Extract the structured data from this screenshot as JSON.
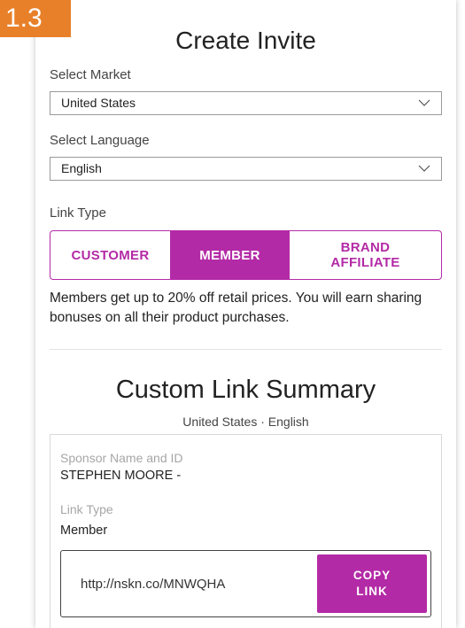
{
  "step_badge": "1.3",
  "title": "Create Invite",
  "market": {
    "label": "Select Market",
    "value": "United States"
  },
  "language": {
    "label": "Select Language",
    "value": "English"
  },
  "link_type": {
    "label": "Link Type",
    "options": [
      "CUSTOMER",
      "MEMBER",
      "BRAND AFFILIATE"
    ],
    "selected": "MEMBER"
  },
  "description": "Members get up to 20% off retail prices. You will earn sharing bonuses on all their product purchases.",
  "summary": {
    "title": "Custom Link Summary",
    "subtitle": "United States · English",
    "sponsor_label": "Sponsor Name and ID",
    "sponsor_value": "STEPHEN MOORE -",
    "link_type_label": "Link Type",
    "link_type_value": "Member",
    "url": "http://nskn.co/MNWQHA",
    "copy_label_line1": "COPY",
    "copy_label_line2": "LINK"
  },
  "colors": {
    "accent": "#b32aa6",
    "badge": "#e8802a"
  }
}
